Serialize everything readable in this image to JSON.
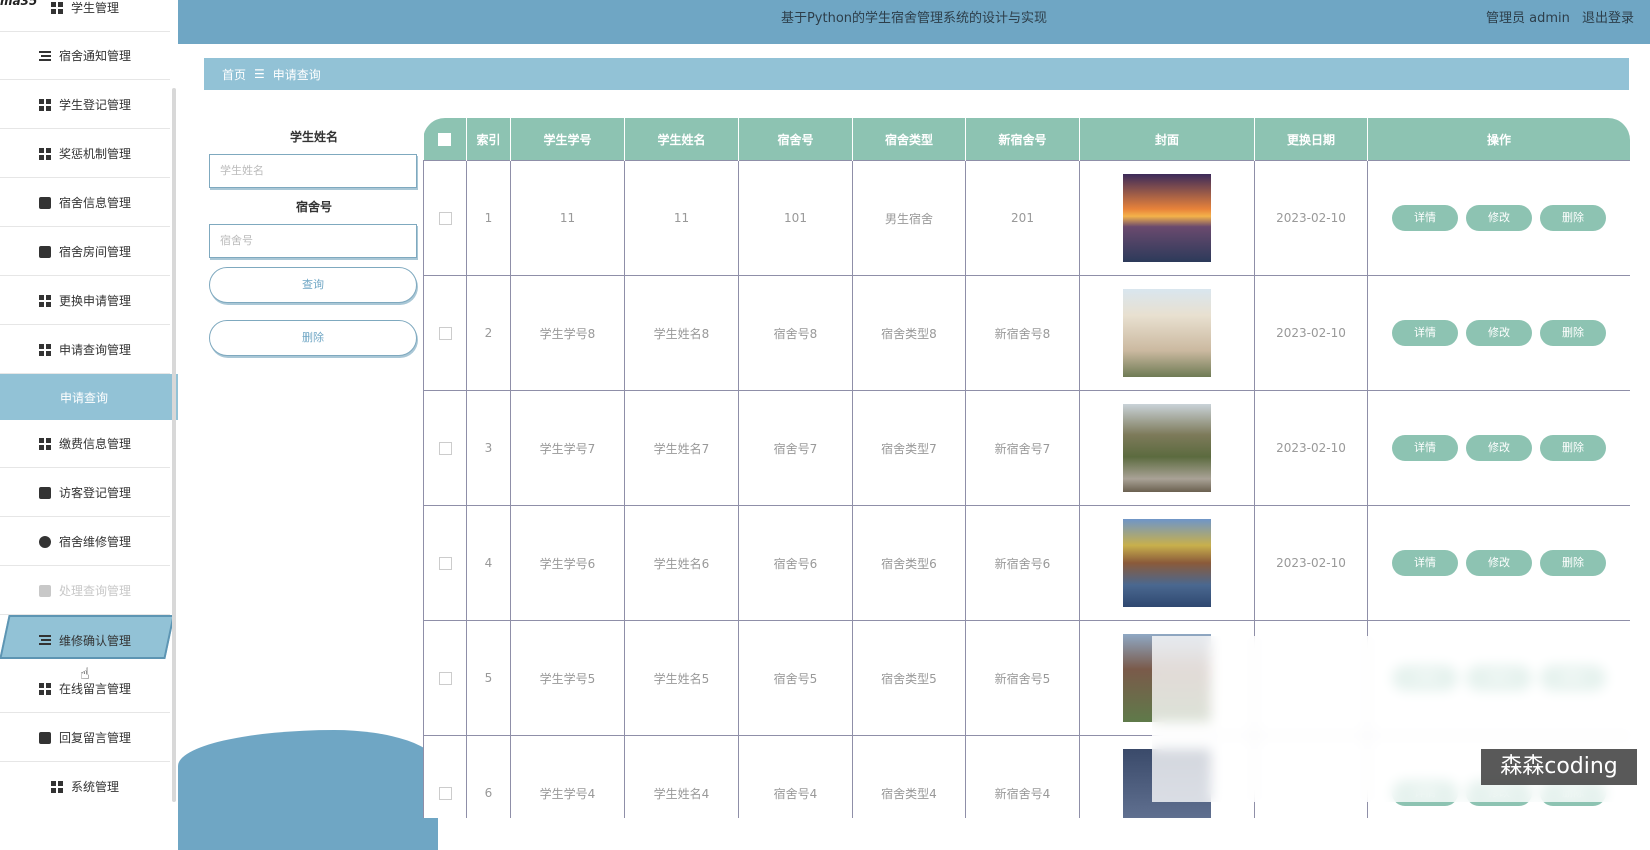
{
  "app": {
    "title": "基于Python的学生宿舍管理系统的设计与实现",
    "user_role": "管理员 admin",
    "logout": "退出登录"
  },
  "sidebar": {
    "items": [
      {
        "label": "学生管理",
        "icon": "grid-icon"
      },
      {
        "label": "宿舍通知管理",
        "icon": "list-icon"
      },
      {
        "label": "学生登记管理",
        "icon": "grid-icon"
      },
      {
        "label": "奖惩机制管理",
        "icon": "grid-icon"
      },
      {
        "label": "宿舍信息管理",
        "icon": "cup-icon"
      },
      {
        "label": "宿舍房间管理",
        "icon": "monitor-icon"
      },
      {
        "label": "更换申请管理",
        "icon": "grid-icon"
      },
      {
        "label": "申请查询管理",
        "icon": "grid-icon"
      },
      {
        "label": "缴费信息管理",
        "icon": "grid-icon"
      },
      {
        "label": "访客登记管理",
        "icon": "chat-icon"
      },
      {
        "label": "宿舍维修管理",
        "icon": "bulb-icon"
      },
      {
        "label": "处理查询管理",
        "icon": "check-icon"
      },
      {
        "label": "维修确认管理",
        "icon": "sliders-icon"
      },
      {
        "label": "在线留言管理",
        "icon": "grid-icon"
      },
      {
        "label": "回复留言管理",
        "icon": "wallet-icon"
      },
      {
        "label": "系统管理",
        "icon": "grid-icon"
      }
    ],
    "submenu_active": "申请查询"
  },
  "breadcrumb": {
    "home": "首页",
    "separator": "☰",
    "current": "申请查询"
  },
  "search": {
    "name_label": "学生姓名",
    "name_placeholder": "学生姓名",
    "room_label": "宿舍号",
    "room_placeholder": "宿舍号",
    "query_button": "查询",
    "delete_button": "删除"
  },
  "table": {
    "columns": [
      "索引",
      "学生学号",
      "学生姓名",
      "宿舍号",
      "宿舍类型",
      "新宿舍号",
      "封面",
      "更换日期",
      "操作"
    ],
    "actions": {
      "detail": "详情",
      "edit": "修改",
      "delete": "删除"
    },
    "rows": [
      {
        "index": "1",
        "student_id": "11",
        "student_name": "11",
        "room": "101",
        "room_type": "男生宿舍",
        "new_room": "201",
        "date": "2023-02-10",
        "cover": "sunset-river"
      },
      {
        "index": "2",
        "student_id": "学生学号8",
        "student_name": "学生姓名8",
        "room": "宿舍号8",
        "room_type": "宿舍类型8",
        "new_room": "新宿舍号8",
        "date": "2023-02-10",
        "cover": "building"
      },
      {
        "index": "3",
        "student_id": "学生学号7",
        "student_name": "学生姓名7",
        "room": "宿舍号7",
        "room_type": "宿舍类型7",
        "new_room": "新宿舍号7",
        "date": "2023-02-10",
        "cover": "garden"
      },
      {
        "index": "4",
        "student_id": "学生学号6",
        "student_name": "学生姓名6",
        "room": "宿舍号6",
        "room_type": "宿舍类型6",
        "new_room": "新宿舍号6",
        "date": "2023-02-10",
        "cover": "lake"
      },
      {
        "index": "5",
        "student_id": "学生学号5",
        "student_name": "学生姓名5",
        "room": "宿舍号5",
        "room_type": "宿舍类型5",
        "new_room": "新宿舍号5",
        "date": "",
        "cover": "campus"
      },
      {
        "index": "6",
        "student_id": "学生学号4",
        "student_name": "学生姓名4",
        "room": "宿舍号4",
        "room_type": "宿舍类型4",
        "new_room": "新宿舍号4",
        "date": "",
        "cover": "campus2"
      }
    ]
  },
  "watermark": "森森coding",
  "colors": {
    "header": "#6fa6c4",
    "accent": "#92c2d6",
    "table_header": "#8dc3b2"
  }
}
